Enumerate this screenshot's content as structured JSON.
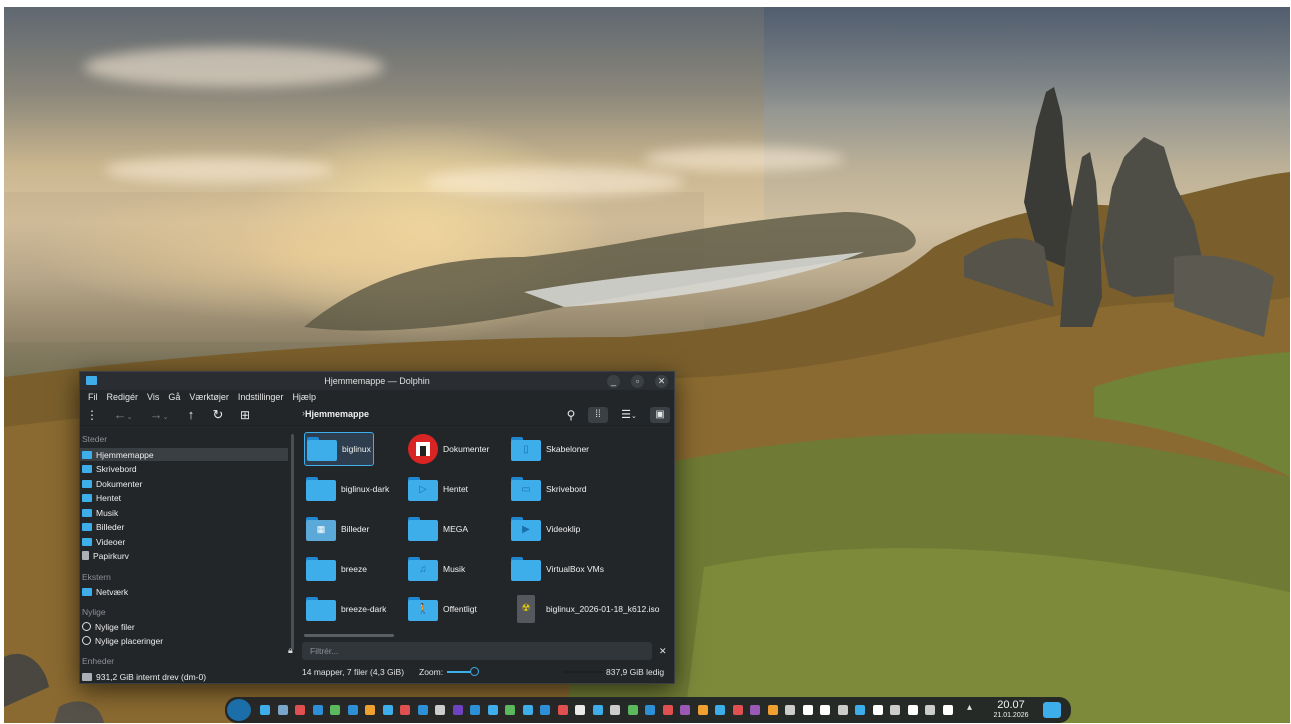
{
  "window": {
    "title": "Hjemmemappe — Dolphin",
    "controls": [
      "_",
      "▫",
      "✕"
    ]
  },
  "menu": [
    "Fil",
    "Redigér",
    "Vis",
    "Gå",
    "Værktøjer",
    "Indstillinger",
    "Hjælp"
  ],
  "toolbar": {
    "breadcrumb": "Hjemmemappe",
    "icons": [
      "menu-icon",
      "back-icon",
      "forward-icon",
      "up-icon",
      "reload-icon",
      "new-window-icon",
      "search-icon",
      "icon-view-icon",
      "details-view-icon",
      "preview-icon"
    ]
  },
  "places": {
    "sections": [
      {
        "header": "Steder",
        "items": [
          "Hjemmemappe",
          "Skrivebord",
          "Dokumenter",
          "Hentet",
          "Musik",
          "Billeder",
          "Videoer",
          "Papirkurv"
        ]
      },
      {
        "header": "Ekstern",
        "items": [
          "Netværk"
        ]
      },
      {
        "header": "Nylige",
        "items": [
          "Nylige filer",
          "Nylige placeringer"
        ]
      },
      {
        "header": "Enheder",
        "items": [
          "931,2 GiB internt drev (dm-0)"
        ]
      }
    ],
    "selected": "Hjemmemappe"
  },
  "files": [
    {
      "name": "biglinux",
      "icon": "folder-icon"
    },
    {
      "name": "Dokumenter",
      "icon": "documents-folder-icon"
    },
    {
      "name": "Skabeloner",
      "icon": "templates-folder-icon"
    },
    {
      "name": "biglinux-dark",
      "icon": "folder-icon"
    },
    {
      "name": "Hentet",
      "icon": "downloads-folder-icon"
    },
    {
      "name": "Skrivebord",
      "icon": "desktop-folder-icon"
    },
    {
      "name": "Billeder",
      "icon": "pictures-folder-icon"
    },
    {
      "name": "MEGA",
      "icon": "folder-icon"
    },
    {
      "name": "Videoklip",
      "icon": "videos-folder-icon"
    },
    {
      "name": "breeze",
      "icon": "folder-icon"
    },
    {
      "name": "Musik",
      "icon": "music-folder-icon"
    },
    {
      "name": "VirtualBox VMs",
      "icon": "folder-icon"
    },
    {
      "name": "breeze-dark",
      "icon": "folder-icon"
    },
    {
      "name": "Offentligt",
      "icon": "public-folder-icon"
    },
    {
      "name": "biglinux_2026-01-18_k612.iso",
      "icon": "iso-file-icon"
    }
  ],
  "filter": {
    "placeholder": "Filtrér..."
  },
  "status": {
    "summary": "14 mapper, 7 filer (4,3 GiB)",
    "zoom_label": "Zoom:",
    "free_space": "837,9 GiB ledig"
  },
  "taskbar": {
    "time": "20.07",
    "date": "21.01.2026",
    "icon_colors": [
      "#3daee9",
      "#7aa6c9",
      "#e05050",
      "#2d8fd6",
      "#5cb85c",
      "#2d8fd6",
      "#f0a030",
      "#3daee9",
      "#e05050",
      "#2d8fd6",
      "#cccccc",
      "#6f42c1",
      "#2d8fd6",
      "#3daee9",
      "#5cb85c",
      "#3daee9",
      "#2d8fd6",
      "#e05050",
      "#e9e9e9",
      "#3daee9",
      "#cccccc",
      "#5cb85c",
      "#2d8fd6",
      "#e05050",
      "#9b59b6",
      "#f0a030",
      "#3daee9",
      "#e05050",
      "#9b59b6",
      "#f0a030",
      "#cccccc",
      "#ffffff",
      "#ffffff",
      "#cccccc",
      "#3daee9",
      "#ffffff",
      "#cccccc",
      "#ffffff",
      "#cccccc",
      "#ffffff"
    ]
  }
}
